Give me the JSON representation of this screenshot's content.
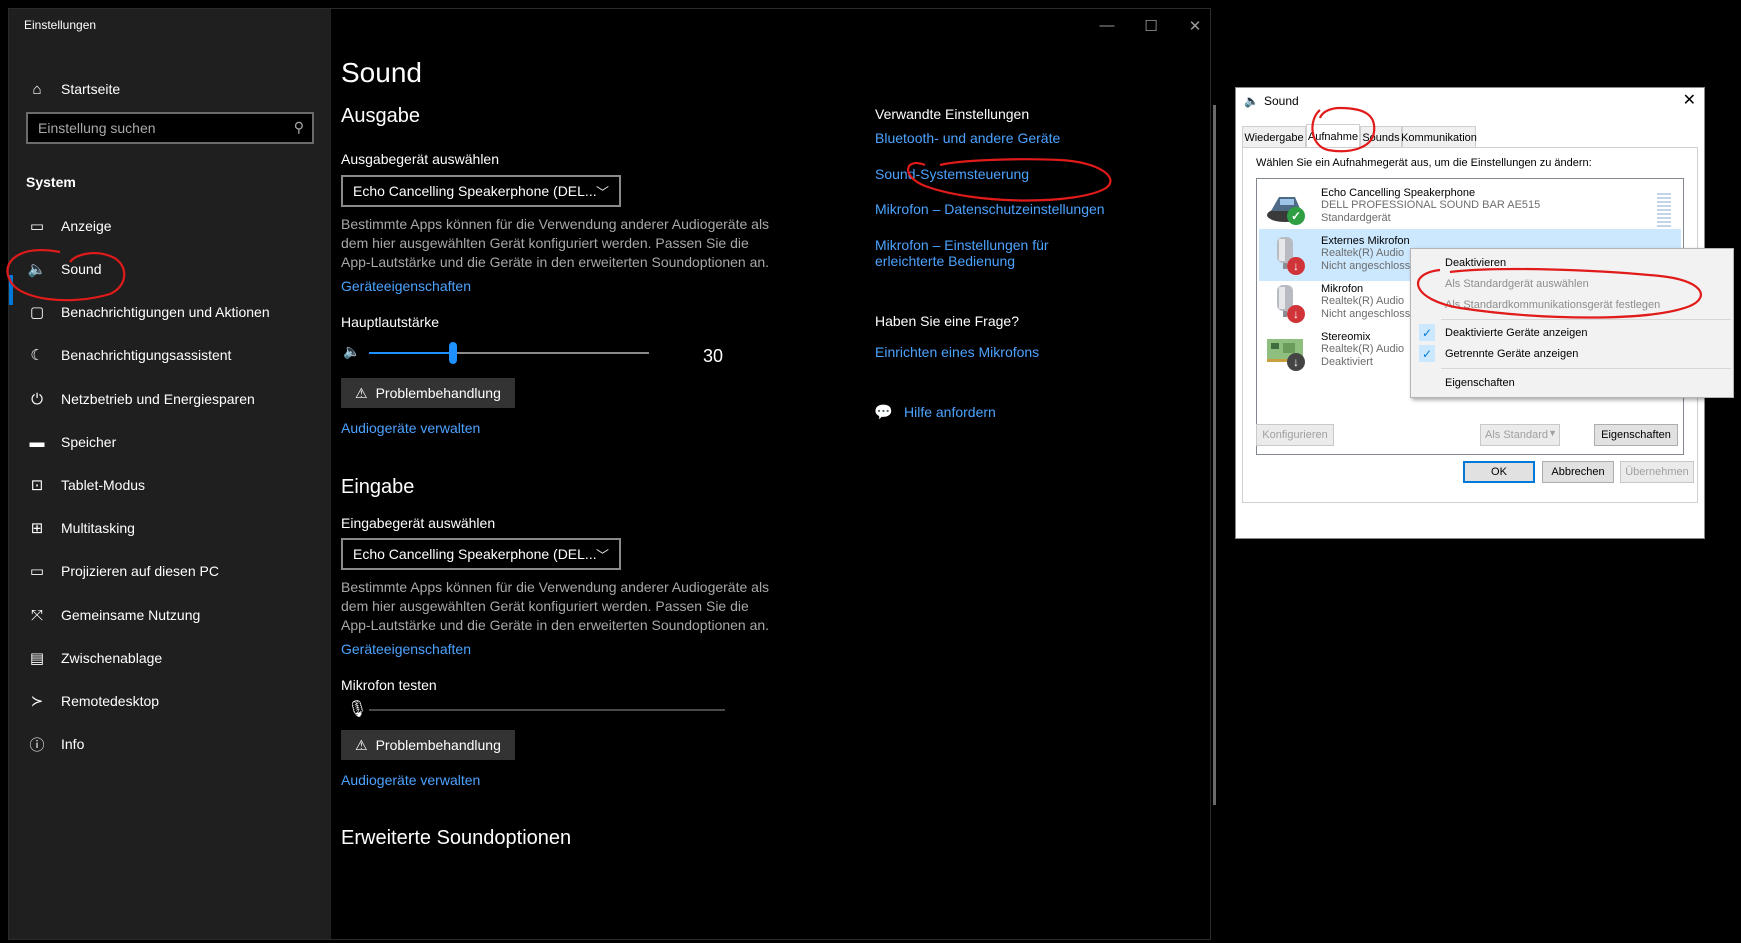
{
  "settings": {
    "window_title": "Einstellungen",
    "home": "Startseite",
    "search_placeholder": "Einstellung suchen",
    "section": "System",
    "nav": [
      {
        "label": "Anzeige",
        "icon": "display-icon"
      },
      {
        "label": "Sound",
        "icon": "speaker-icon"
      },
      {
        "label": "Benachrichtigungen und Aktionen",
        "icon": "notification-icon"
      },
      {
        "label": "Benachrichtigungsassistent",
        "icon": "moon-icon"
      },
      {
        "label": "Netzbetrieb und Energiesparen",
        "icon": "power-icon"
      },
      {
        "label": "Speicher",
        "icon": "storage-icon"
      },
      {
        "label": "Tablet-Modus",
        "icon": "tablet-icon"
      },
      {
        "label": "Multitasking",
        "icon": "multitasking-icon"
      },
      {
        "label": "Projizieren auf diesen PC",
        "icon": "project-icon"
      },
      {
        "label": "Gemeinsame Nutzung",
        "icon": "share-icon"
      },
      {
        "label": "Zwischenablage",
        "icon": "clipboard-icon"
      },
      {
        "label": "Remotedesktop",
        "icon": "remote-icon"
      },
      {
        "label": "Info",
        "icon": "info-icon"
      }
    ],
    "active_nav": "Sound",
    "accent": "#0078d7"
  },
  "main": {
    "title": "Sound",
    "output": {
      "heading": "Ausgabe",
      "device_label": "Ausgabegerät auswählen",
      "device_value": "Echo Cancelling Speakerphone (DEL...",
      "description": "Bestimmte Apps können für die Verwendung anderer Audiogeräte als dem hier ausgewählten Gerät konfiguriert werden. Passen Sie die App-Lautstärke und die Geräte in den erweiterten Soundoptionen an.",
      "properties_link": "Geräteeigenschaften",
      "volume_label": "Hauptlautstärke",
      "volume_value": "30",
      "volume_fraction": 0.3,
      "troubleshoot": "Problembehandlung",
      "manage_link": "Audiogeräte verwalten"
    },
    "input": {
      "heading": "Eingabe",
      "device_label": "Eingabegerät auswählen",
      "device_value": "Echo Cancelling Speakerphone (DEL...",
      "description": "Bestimmte Apps können für die Verwendung anderer Audiogeräte als dem hier ausgewählten Gerät konfiguriert werden. Passen Sie die App-Lautstärke und die Geräte in den erweiterten Soundoptionen an.",
      "properties_link": "Geräteeigenschaften",
      "mic_test_label": "Mikrofon testen",
      "troubleshoot": "Problembehandlung",
      "manage_link": "Audiogeräte verwalten"
    },
    "advanced_heading": "Erweiterte Soundoptionen",
    "related": {
      "heading": "Verwandte Einstellungen",
      "links": [
        "Bluetooth- und andere Geräte",
        "Sound-Systemsteuerung",
        "Mikrofon – Datenschutzeinstellungen",
        "Mikrofon – Einstellungen für",
        "erleichterte Bedienung"
      ]
    },
    "question": {
      "heading": "Haben Sie eine Frage?",
      "link": "Einrichten eines Mikrofons",
      "help": "Hilfe anfordern"
    },
    "link_color": "#4ca3ff"
  },
  "dialog": {
    "title": "Sound",
    "tabs": [
      "Wiedergabe",
      "Aufnahme",
      "Sounds",
      "Kommunikation"
    ],
    "active_tab": "Aufnahme",
    "prompt": "Wählen Sie ein Aufnahmegerät aus, um die Einstellungen zu ändern:",
    "devices": [
      {
        "name": "Echo Cancelling Speakerphone",
        "line2": "DELL PROFESSIONAL SOUND BAR AE515",
        "line3": "Standardgerät",
        "icon": "speakerphone-icon",
        "status": "default"
      },
      {
        "name": "Externes Mikrofon",
        "line2": "Realtek(R) Audio",
        "line3": "Nicht angeschlossen",
        "icon": "microphone-icon",
        "status": "unplugged"
      },
      {
        "name": "Mikrofon",
        "line2": "Realtek(R) Audio",
        "line3": "Nicht angeschlossen",
        "icon": "microphone-icon",
        "status": "unplugged"
      },
      {
        "name": "Stereomix",
        "line2": "Realtek(R) Audio",
        "line3": "Deaktiviert",
        "icon": "circuit-board-icon",
        "status": "disabled"
      }
    ],
    "buttons": {
      "configure": "Konfigurieren",
      "set_default": "Als Standard",
      "properties": "Eigenschaften",
      "ok": "OK",
      "cancel": "Abbrechen",
      "apply": "Übernehmen"
    }
  },
  "context_menu": {
    "items": [
      {
        "label": "Deaktivieren",
        "enabled": true,
        "checked": false
      },
      {
        "label": "Als Standardgerät auswählen",
        "enabled": false,
        "checked": false
      },
      {
        "label": "Als Standardkommunikationsgerät festlegen",
        "enabled": false,
        "checked": false
      },
      {
        "label": "Deaktivierte Geräte anzeigen",
        "enabled": true,
        "checked": true
      },
      {
        "label": "Getrennte Geräte anzeigen",
        "enabled": true,
        "checked": true
      },
      {
        "label": "Eigenschaften",
        "enabled": true,
        "checked": false
      }
    ]
  },
  "annotation_color": "#e11a1a"
}
